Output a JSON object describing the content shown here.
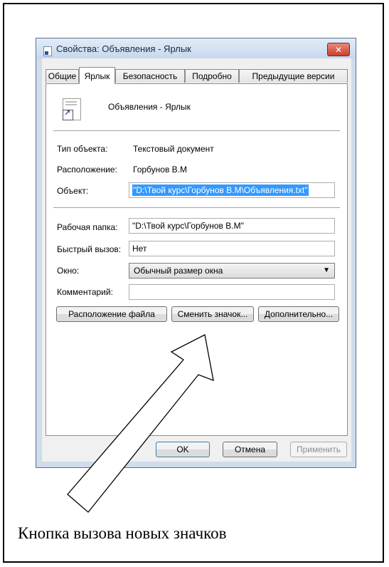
{
  "window": {
    "title": "Свойства: Объявления - Ярлык",
    "close_label": "✕"
  },
  "tabs": [
    {
      "label": "Общие",
      "active": false
    },
    {
      "label": "Ярлык",
      "active": true
    },
    {
      "label": "Безопасность",
      "active": false
    },
    {
      "label": "Подробно",
      "active": false
    },
    {
      "label": "Предыдущие версии",
      "active": false
    }
  ],
  "shortcut": {
    "icon": "shortcut-file-icon",
    "name": "Объявления - Ярлык"
  },
  "info": {
    "type_label": "Тип объекта:",
    "type_value": "Текстовый документ",
    "location_label": "Расположение:",
    "location_value": "Горбунов В.М",
    "target_label": "Объект:",
    "target_value": "\"D:\\Твой курс\\Горбунов В.М\\Объявления.txt\""
  },
  "fields": {
    "workdir_label": "Рабочая папка:",
    "workdir_value": "\"D:\\Твой курс\\Горбунов В.М\"",
    "hotkey_label": "Быстрый вызов:",
    "hotkey_value": "Нет",
    "window_label": "Окно:",
    "window_value": "Обычный размер окна",
    "comment_label": "Комментарий:",
    "comment_value": ""
  },
  "action_buttons": {
    "open_location": "Расположение файла",
    "change_icon": "Сменить значок...",
    "advanced": "Дополнительно..."
  },
  "footer_buttons": {
    "ok": "OK",
    "cancel": "Отмена",
    "apply": "Применить"
  },
  "caption": "Кнопка вызова новых значков",
  "colors": {
    "selection": "#3399ff",
    "close_button": "#c8402e",
    "titlebar": "#c7d8ee"
  }
}
